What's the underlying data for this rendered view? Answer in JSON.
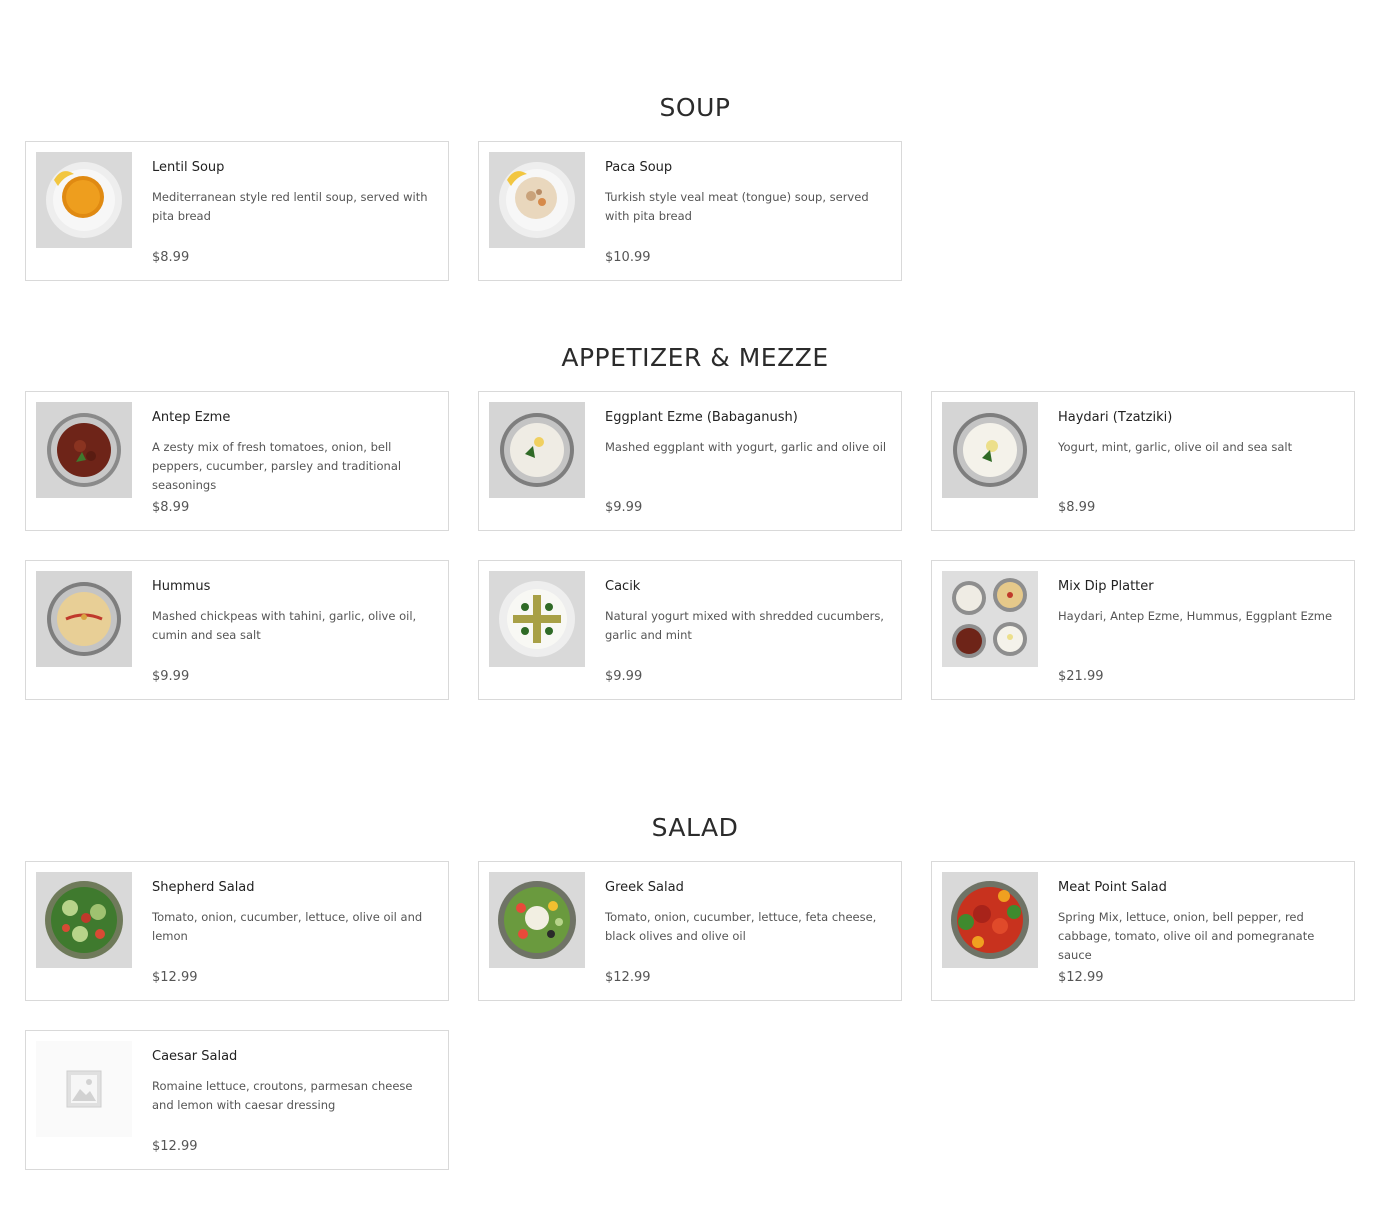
{
  "sections": [
    {
      "title": "SOUP",
      "items": [
        {
          "name": "Lentil Soup",
          "description": "Mediterranean style red lentil soup, served with pita bread",
          "price": "$8.99",
          "image": "lentil-soup-image"
        },
        {
          "name": "Paca Soup",
          "description": "Turkish style veal meat (tongue) soup, served with pita bread",
          "price": "$10.99",
          "image": "paca-soup-image"
        }
      ]
    },
    {
      "title": "APPETIZER & MEZZE",
      "items": [
        {
          "name": "Antep Ezme",
          "description": "A zesty mix of fresh tomatoes, onion, bell peppers, cucumber, parsley and traditional seasonings",
          "price": "$8.99",
          "image": "antep-ezme-image"
        },
        {
          "name": "Eggplant Ezme (Babaganush)",
          "description": "Mashed eggplant with yogurt, garlic and olive oil",
          "price": "$9.99",
          "image": "eggplant-ezme-image"
        },
        {
          "name": "Haydari (Tzatziki)",
          "description": "Yogurt, mint, garlic, olive oil and sea salt",
          "price": "$8.99",
          "image": "haydari-image"
        },
        {
          "name": "Hummus",
          "description": "Mashed chickpeas with tahini, garlic, olive oil, cumin and sea salt",
          "price": "$9.99",
          "image": "hummus-image"
        },
        {
          "name": "Cacik",
          "description": "Natural yogurt mixed with shredded cucumbers, garlic and mint",
          "price": "$9.99",
          "image": "cacik-image"
        },
        {
          "name": "Mix Dip Platter",
          "description": "Haydari, Antep Ezme, Hummus, Eggplant Ezme",
          "price": "$21.99",
          "image": "mix-dip-platter-image"
        }
      ]
    },
    {
      "title": "SALAD",
      "items": [
        {
          "name": "Shepherd Salad",
          "description": "Tomato, onion, cucumber, lettuce, olive oil and lemon",
          "price": "$12.99",
          "image": "shepherd-salad-image"
        },
        {
          "name": "Greek Salad",
          "description": "Tomato, onion, cucumber, lettuce, feta cheese, black olives and olive oil",
          "price": "$12.99",
          "image": "greek-salad-image"
        },
        {
          "name": "Meat Point Salad",
          "description": "Spring Mix, lettuce, onion, bell pepper, red cabbage, tomato, olive oil and pomegranate sauce",
          "price": "$12.99",
          "image": "meat-point-salad-image"
        },
        {
          "name": "Caesar Salad",
          "description": "Romaine lettuce, croutons, parmesan cheese and lemon with caesar dressing",
          "price": "$12.99",
          "image": "placeholder-image-icon"
        }
      ]
    }
  ]
}
